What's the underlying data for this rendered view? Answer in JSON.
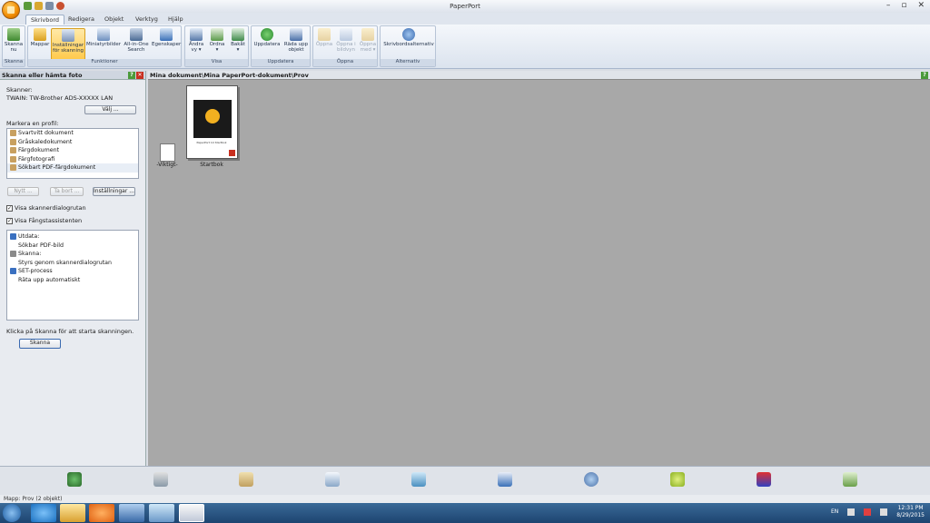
{
  "app": {
    "title": "PaperPort"
  },
  "tabs": [
    "Skrivbord",
    "Redigera",
    "Objekt",
    "Verktyg",
    "Hjälp"
  ],
  "ribbon": {
    "groups": {
      "skanna": "Skanna",
      "funktioner": "Funktioner",
      "visa": "Visa",
      "uppdatera": "Uppdatera",
      "oppna": "Öppna",
      "alternativ": "Alternativ"
    },
    "buttons": {
      "skanna_nu_1": "Skanna",
      "skanna_nu_2": "nu",
      "mappar": "Mappar",
      "install_1": "Inställningar",
      "install_2": "för skanning",
      "miniatyr": "Miniatyrbilder",
      "allinone_1": "All-in-One",
      "allinone_2": "Search",
      "egenskaper": "Egenskaper",
      "andra_1": "Ändra",
      "andra_2": "vy ▾",
      "ordna_1": "Ordna",
      "ordna_2": "▾",
      "bakat_1": "Bakåt",
      "bakat_2": "▾",
      "uppdatera": "Uppdatera",
      "rada_1": "Räda upp",
      "rada_2": "objekt",
      "oppna": "Öppna",
      "oppna_bild_1": "Öppna i",
      "oppna_bild_2": "bildvyn",
      "oppna_med_1": "Öppna",
      "oppna_med_2": "med ▾",
      "skrivbords": "Skrivbordsalternativ"
    }
  },
  "left": {
    "title": "Skanna eller hämta foto",
    "scanner_label": "Skanner:",
    "scanner_value": "TWAIN: TW-Brother ADS-XXXXX LAN",
    "valj": "Välj ...",
    "profile_label": "Markera en profil:",
    "profiles": [
      "Svartvitt dokument",
      "Gråskaledokument",
      "Färgdokument",
      "Färgfotografi",
      "Sökbart PDF-färgdokument"
    ],
    "nytt": "Nytt ...",
    "tabort": "Ta bort ...",
    "installningar": "Inställningar ...",
    "chk1": "Visa skannerdialogrutan",
    "chk2": "Visa Fångstassistenten",
    "details": [
      "Utdata:",
      "Sökbar PDF-bild",
      "Skanna:",
      "Styrs genom skannerdialogrutan",
      "SET-process",
      "Räta upp automatiskt"
    ],
    "hint": "Klicka på Skanna för att starta skanningen.",
    "skanna_btn": "Skanna"
  },
  "doc": {
    "path": "Mina dokument\\Mina PaperPort-dokument\\Prov",
    "items": [
      "-Viktigt-",
      "Startbok"
    ],
    "cover_caption": "PaperPort 14 Startbok"
  },
  "status": {
    "left": "Mapp: Prov (2 objekt)"
  },
  "tray": {
    "lang": "EN",
    "time": "12:31 PM",
    "date": "8/29/2015"
  }
}
